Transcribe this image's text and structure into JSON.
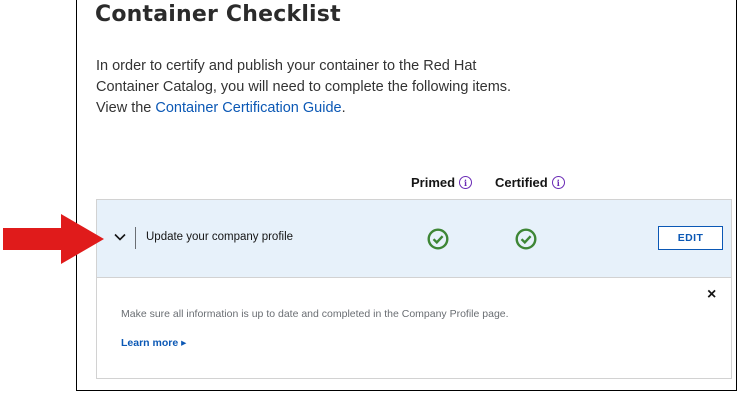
{
  "title": "Container Checklist",
  "intro": {
    "line1": "In order to certify and publish your container to the Red Hat",
    "line2": "Container Catalog, you will need to complete the following items.",
    "line3_prefix": "View the ",
    "guide_link": "Container Certification Guide",
    "line3_suffix": "."
  },
  "columns": {
    "primed": "Primed",
    "certified": "Certified",
    "info_icon": "info-icon"
  },
  "item": {
    "label": "Update your company profile",
    "primed_status": "check-circle-icon",
    "certified_status": "check-circle-icon",
    "edit_label": "EDIT",
    "detail": "Make sure all information is up to date and completed in the Company Profile page.",
    "learn_more": "Learn more ▸",
    "close": "×"
  },
  "colors": {
    "accent": "#0b58b5",
    "success": "#3e8635",
    "info": "#6a2bb5",
    "arrow": "#e01b1b",
    "row_bg": "#e7f1fa"
  }
}
